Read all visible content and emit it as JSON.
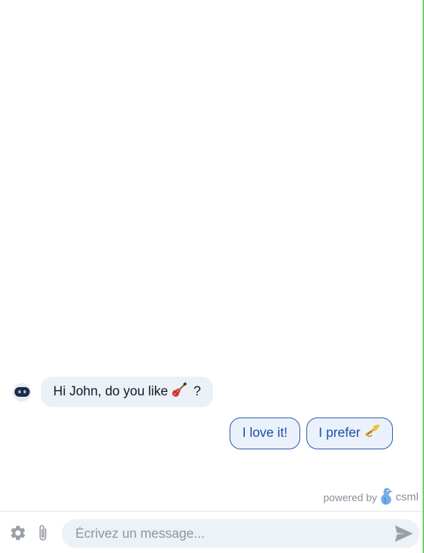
{
  "conversation": {
    "bot_message": {
      "prefix": "Hi John, do you like",
      "emoji_icon": "guitar-icon",
      "suffix": "?"
    },
    "quick_replies": [
      {
        "label": "I love it!"
      },
      {
        "label": "I prefer",
        "emoji_icon": "trumpet-icon"
      }
    ]
  },
  "branding": {
    "powered_by": "powered by",
    "brand": "csml",
    "logo_icon": "csml-bird-logo"
  },
  "composer": {
    "placeholder": "Écrivez un message...",
    "value": ""
  },
  "colors": {
    "accent": "#1d4fa6",
    "bubble_bg": "#ebf1f6",
    "button_bg": "#eaf1fb",
    "input_bg": "#edf2f7",
    "right_border": "#69d15f",
    "icon_gray": "#9aa0a8"
  }
}
